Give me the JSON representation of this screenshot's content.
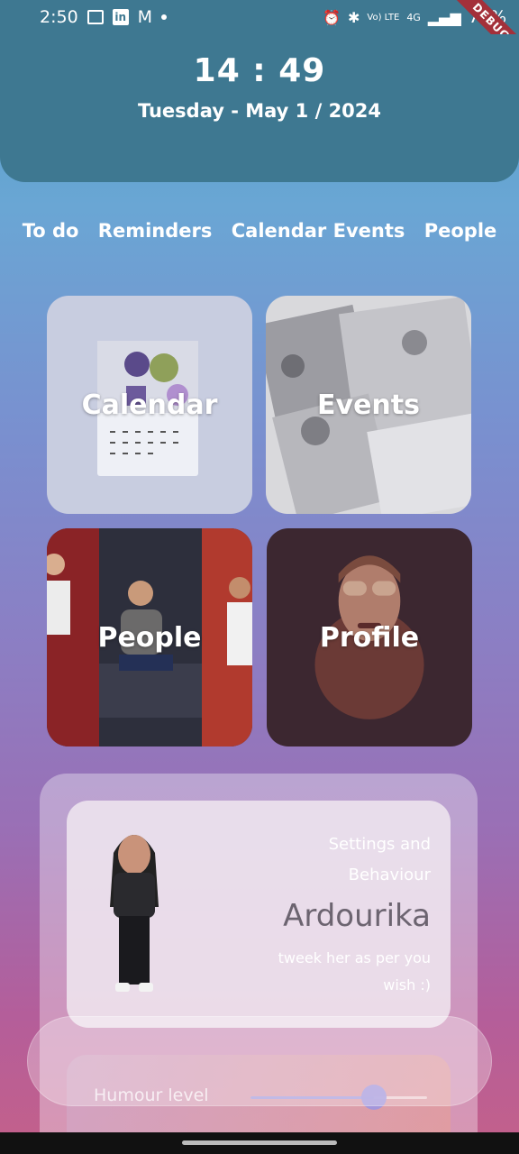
{
  "status_bar": {
    "time": "2:50",
    "left_icons": [
      "gallery-icon",
      "linkedin-icon",
      "gmail-icon",
      "dot-icon"
    ],
    "right_icons": [
      "alarm-icon",
      "bluetooth-icon",
      "volte-icon",
      "4g-icon",
      "signal-icon"
    ],
    "volte_text": "Vo) LTE",
    "net_text": "4G",
    "battery": "74%",
    "debug_label": "DEBUG"
  },
  "clock": {
    "time": "14 : 49",
    "date": "Tuesday - May 1 / 2024"
  },
  "tabs": [
    "To do",
    "Reminders",
    "Calendar Events",
    "People"
  ],
  "cards": {
    "calendar": "Calendar",
    "events": "Events",
    "people": "People",
    "profile": "Profile"
  },
  "settings": {
    "title": "Settings and Behaviour",
    "name": "Ardourika",
    "subtitle": "tweek her as per you wish :)"
  },
  "humour": {
    "label": "Humour level",
    "level": 0.7
  },
  "colors": {
    "header": "#3e7891",
    "accent": "#a096dc"
  }
}
